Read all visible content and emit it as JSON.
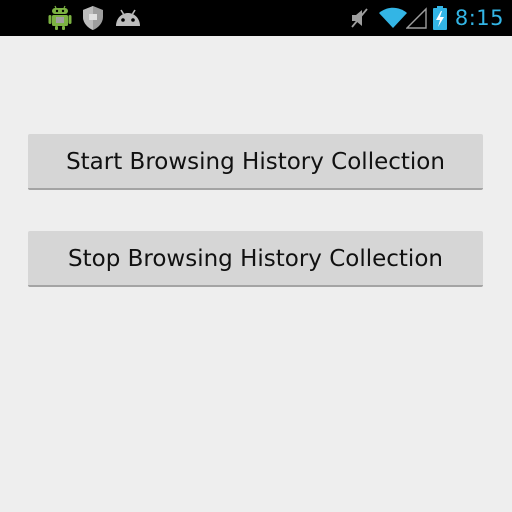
{
  "status_bar": {
    "time": "8:15",
    "accent_color": "#33b5e5",
    "notification_icons": [
      "android-robot-icon",
      "shield-icon",
      "android-head-icon"
    ],
    "system_icons": [
      "muted-speaker-icon",
      "wifi-icon",
      "signal-icon",
      "battery-charging-icon"
    ]
  },
  "main": {
    "start_button_label": "Start Browsing History Collection",
    "stop_button_label": "Stop Browsing History Collection"
  }
}
